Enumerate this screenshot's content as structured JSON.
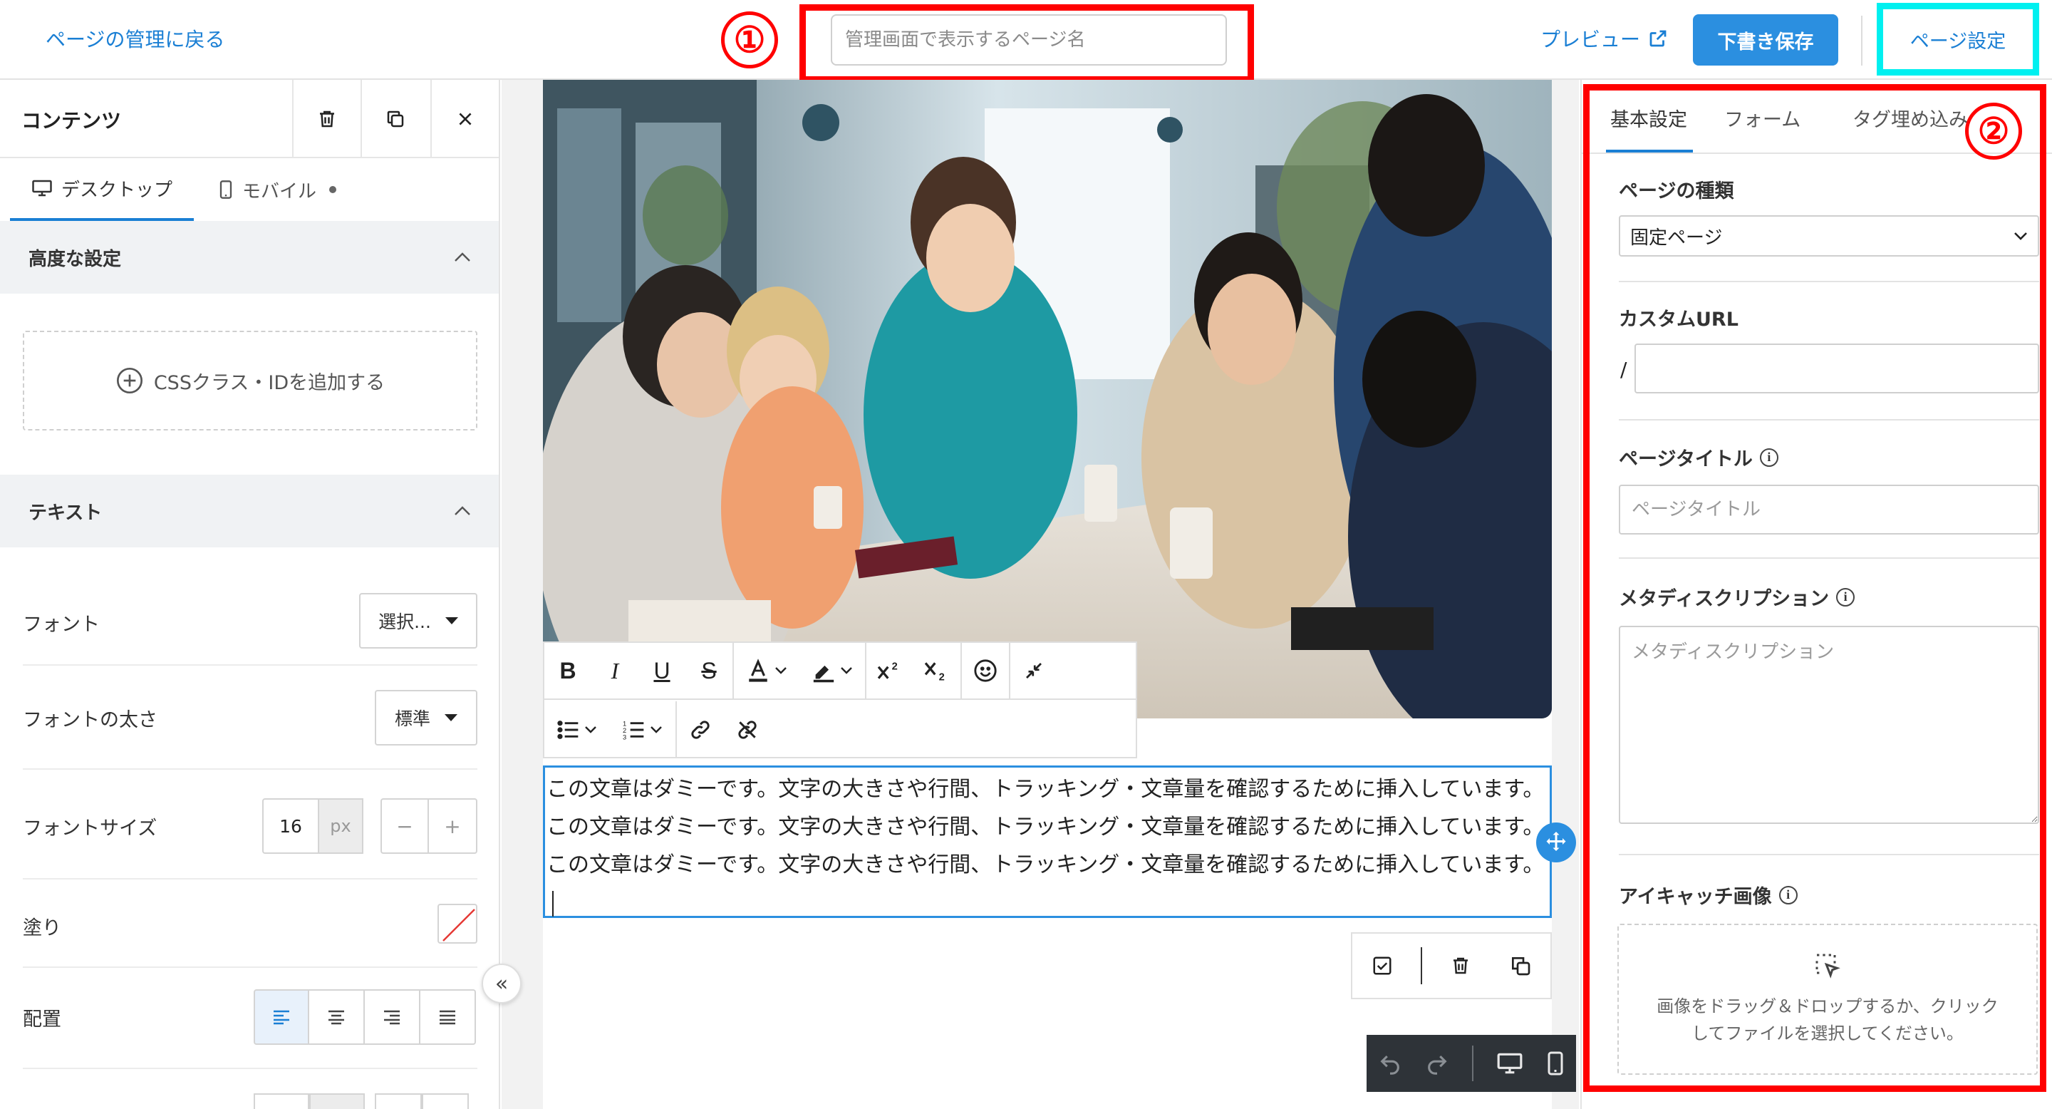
{
  "topbar": {
    "back_label": "ページの管理に戻る",
    "page_name_placeholder": "管理画面で表示するページ名",
    "preview_label": "プレビュー",
    "draft_save_label": "下書き保存",
    "page_settings_label": "ページ設定"
  },
  "annotations": {
    "marker1": "①",
    "marker2": "②",
    "color_red": "#ff0000",
    "color_cyan": "#00f0f0"
  },
  "left_panel": {
    "title": "コンテンツ",
    "tabs": {
      "desktop": "デスクトップ",
      "mobile": "モバイル"
    },
    "advanced": {
      "heading": "高度な設定",
      "add_css_label": "CSSクラス・IDを追加する"
    },
    "text_section": {
      "heading": "テキスト",
      "font_label": "フォント",
      "font_value": "選択...",
      "weight_label": "フォントの太さ",
      "weight_value": "標準",
      "size_label": "フォントサイズ",
      "size_value": "16",
      "size_unit": "px",
      "minus": "−",
      "plus": "+",
      "fill_label": "塗り",
      "align_label": "配置"
    },
    "collapse_glyph": "«"
  },
  "canvas": {
    "body_text": "この文章はダミーです。文字の大きさや行間、トラッキング・文章量を確認するために挿入しています。この文章はダミーです。文字の大きさや行間、トラッキング・文章量を確認するために挿入しています。この文章はダミーです。文字の大きさや行間、トラッキング・文章量を確認するために挿入しています。"
  },
  "right_panel": {
    "tabs": [
      "基本設定",
      "フォーム",
      "タグ埋め込み"
    ],
    "page_type": {
      "label": "ページの種類",
      "value": "固定ページ"
    },
    "custom_url": {
      "label": "カスタムURL",
      "prefix": "/"
    },
    "page_title": {
      "label": "ページタイトル",
      "placeholder": "ページタイトル"
    },
    "meta_description": {
      "label": "メタディスクリプション",
      "placeholder": "メタディスクリプション"
    },
    "eyecatch": {
      "label": "アイキャッチ画像",
      "drop_text": "画像をドラッグ＆ドロップするか、クリックしてファイルを選択してください。"
    },
    "info_glyph": "i"
  },
  "colors": {
    "accent": "#2b8fe0",
    "link": "#1a7fd4"
  }
}
